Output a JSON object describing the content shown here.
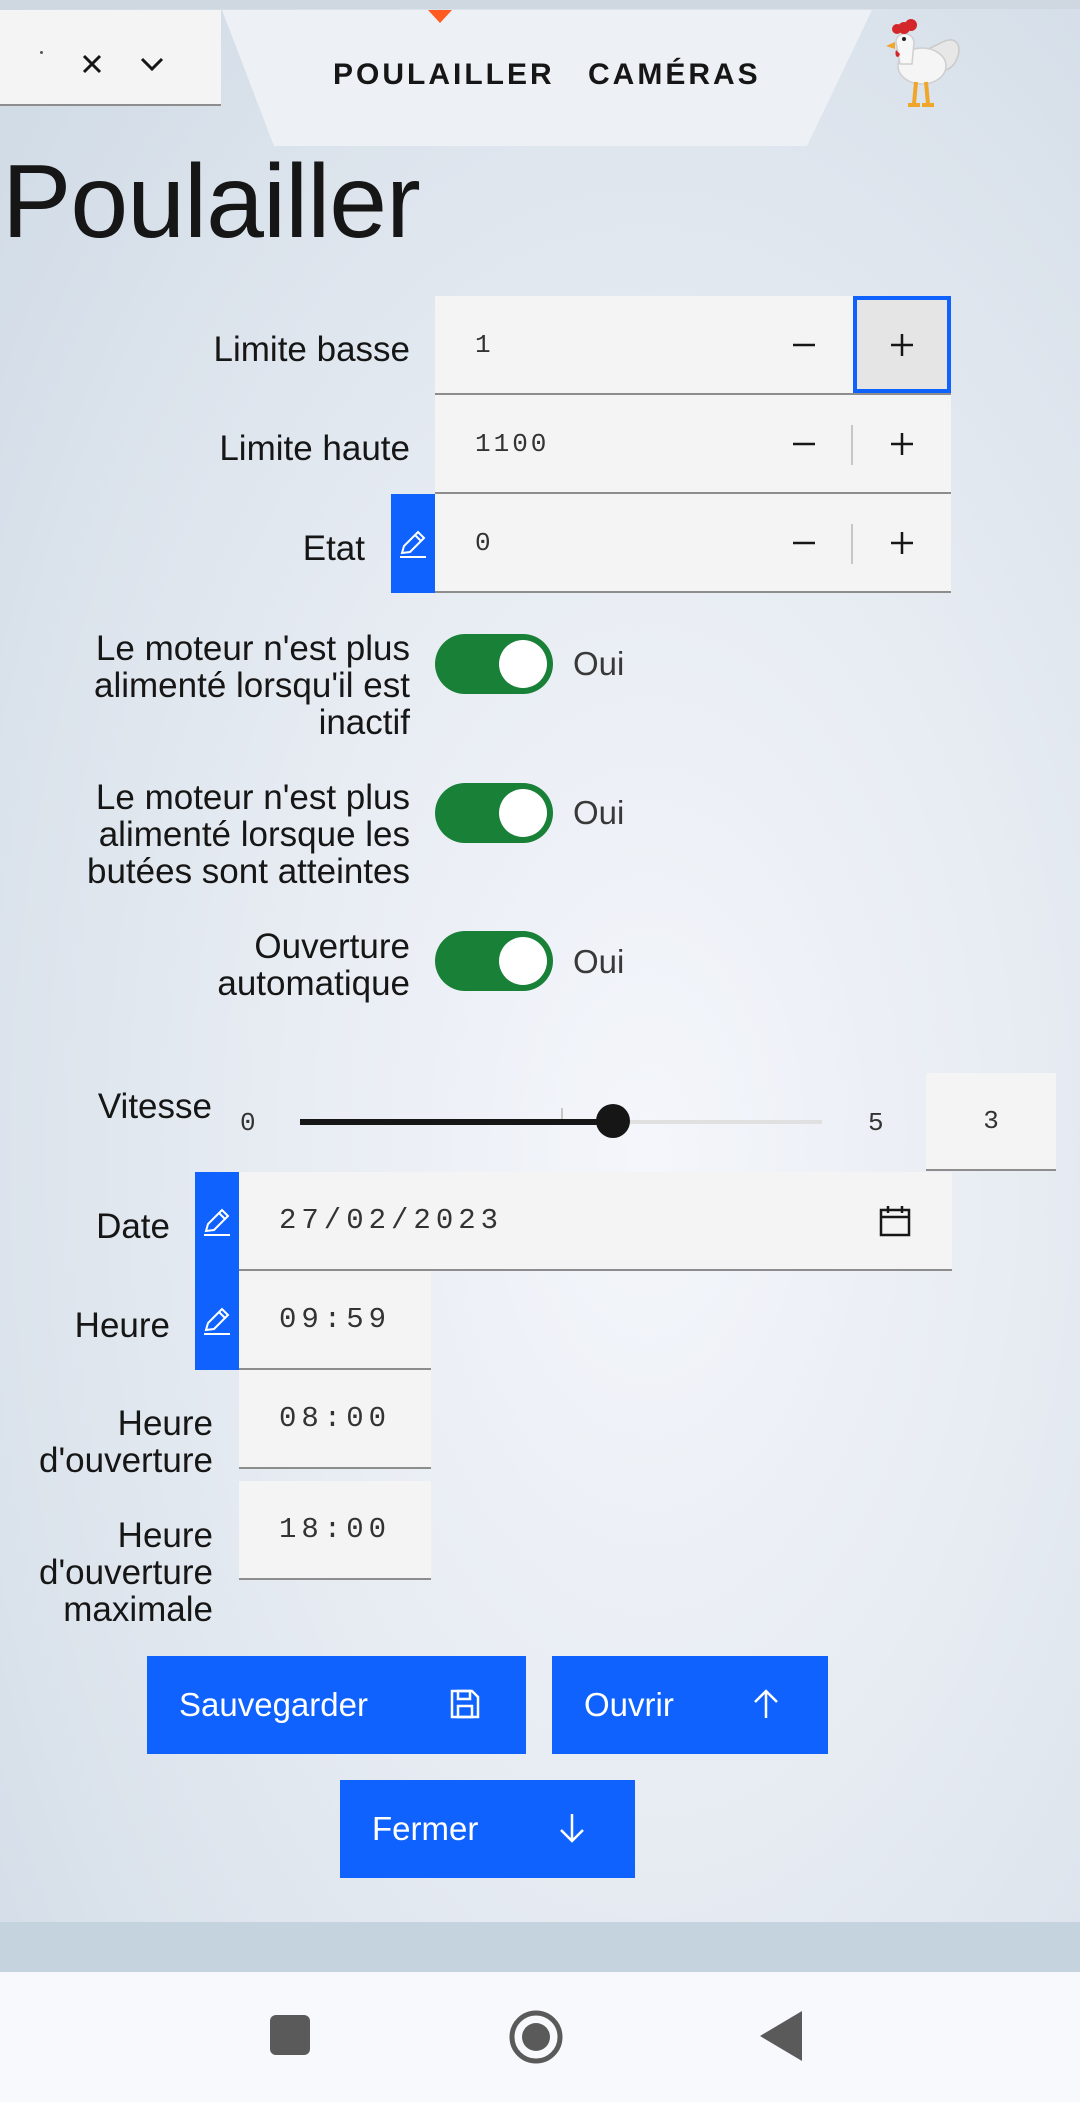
{
  "header": {
    "tabs": [
      {
        "label": "POULAILLER"
      },
      {
        "label": "CAMÉRAS"
      }
    ]
  },
  "page": {
    "title": "Poulailler"
  },
  "numbers": [
    {
      "label": "Limite basse",
      "value": "1"
    },
    {
      "label": "Limite haute",
      "value": "1100"
    },
    {
      "label": "Etat",
      "value": "0"
    }
  ],
  "toggles": [
    {
      "label": [
        "Le moteur n'est plus",
        "alimenté lorsqu'il est",
        "inactif"
      ],
      "state": "Oui",
      "on": true
    },
    {
      "label": [
        "Le moteur n'est plus",
        "alimenté lorsque les",
        "butées sont atteintes"
      ],
      "state": "Oui",
      "on": true
    },
    {
      "label": [
        "Ouverture",
        "automatique"
      ],
      "state": "Oui",
      "on": true
    }
  ],
  "speed": {
    "label": "Vitesse",
    "min": "0",
    "max": "5",
    "value": "3",
    "fraction": 0.6
  },
  "date": {
    "label": "Date",
    "value": "27/02/2023"
  },
  "time": {
    "label": "Heure",
    "value": "09:59"
  },
  "open_time": {
    "label": [
      "Heure",
      "d'ouverture"
    ],
    "value": "08:00"
  },
  "max_open_time": {
    "label": [
      "Heure",
      "d'ouverture",
      "maximale"
    ],
    "value": "18:00"
  },
  "buttons": {
    "save": "Sauvegarder",
    "open": "Ouvrir",
    "close": "Fermer"
  },
  "colors": {
    "accent": "#0f62fe",
    "toggle_on": "#198038",
    "nav_indicator": "#ff5a1f"
  }
}
